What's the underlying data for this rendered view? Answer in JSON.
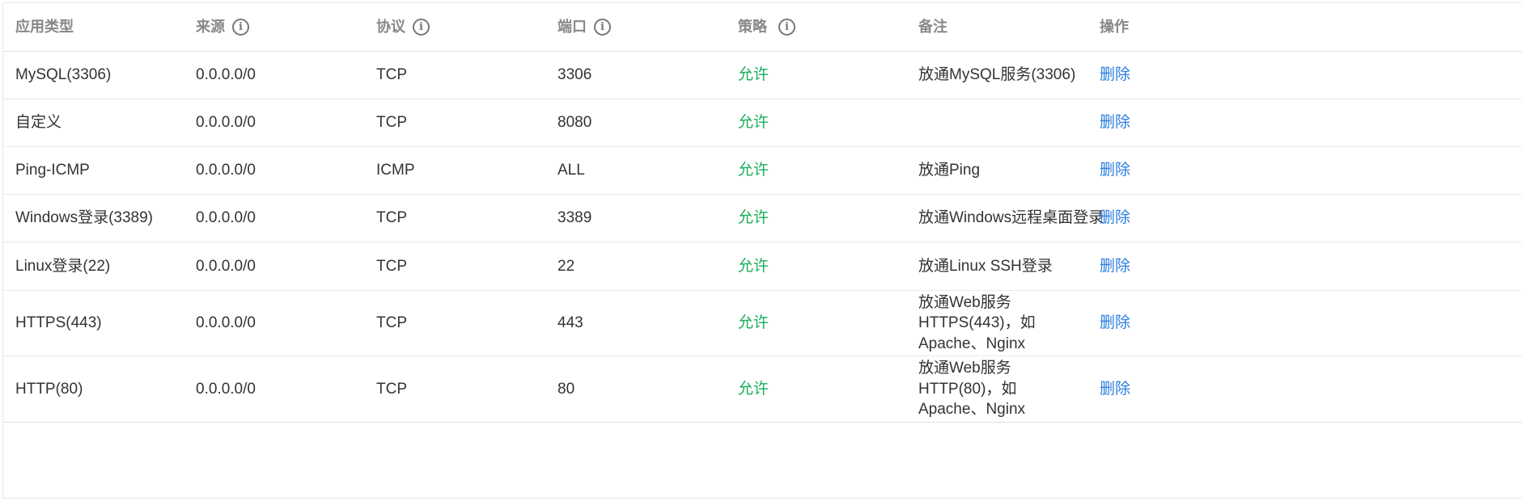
{
  "columns": [
    {
      "label": "应用类型",
      "info": false
    },
    {
      "label": "来源",
      "info": true
    },
    {
      "label": "协议",
      "info": true
    },
    {
      "label": "端口",
      "info": true
    },
    {
      "label": "策略",
      "info": true
    },
    {
      "label": "备注",
      "info": false
    },
    {
      "label": "操作",
      "info": false
    }
  ],
  "rows": [
    {
      "app": "MySQL(3306)",
      "source": "0.0.0.0/0",
      "protocol": "TCP",
      "port": "3306",
      "policy": "允许",
      "note": "放通MySQL服务(3306)",
      "action": "删除"
    },
    {
      "app": "自定义",
      "source": "0.0.0.0/0",
      "protocol": "TCP",
      "port": "8080",
      "policy": "允许",
      "note": "",
      "action": "删除"
    },
    {
      "app": "Ping-ICMP",
      "source": "0.0.0.0/0",
      "protocol": "ICMP",
      "port": "ALL",
      "policy": "允许",
      "note": "放通Ping",
      "action": "删除"
    },
    {
      "app": "Windows登录(3389)",
      "source": "0.0.0.0/0",
      "protocol": "TCP",
      "port": "3389",
      "policy": "允许",
      "note": "放通Windows远程桌面登录",
      "action": "删除"
    },
    {
      "app": "Linux登录(22)",
      "source": "0.0.0.0/0",
      "protocol": "TCP",
      "port": "22",
      "policy": "允许",
      "note": "放通Linux SSH登录",
      "action": "删除"
    },
    {
      "app": "HTTPS(443)",
      "source": "0.0.0.0/0",
      "protocol": "TCP",
      "port": "443",
      "policy": "允许",
      "note": "放通Web服务HTTPS(443)，如 Apache、Nginx",
      "action": "删除"
    },
    {
      "app": "HTTP(80)",
      "source": "0.0.0.0/0",
      "protocol": "TCP",
      "port": "80",
      "policy": "允许",
      "note": "放通Web服务HTTP(80)，如 Apache、Nginx",
      "action": "删除"
    }
  ],
  "colors": {
    "allow": "#1aad5a",
    "link": "#2a7de1",
    "header_text": "#888888"
  },
  "icons": {
    "info": "info-circle-icon"
  }
}
